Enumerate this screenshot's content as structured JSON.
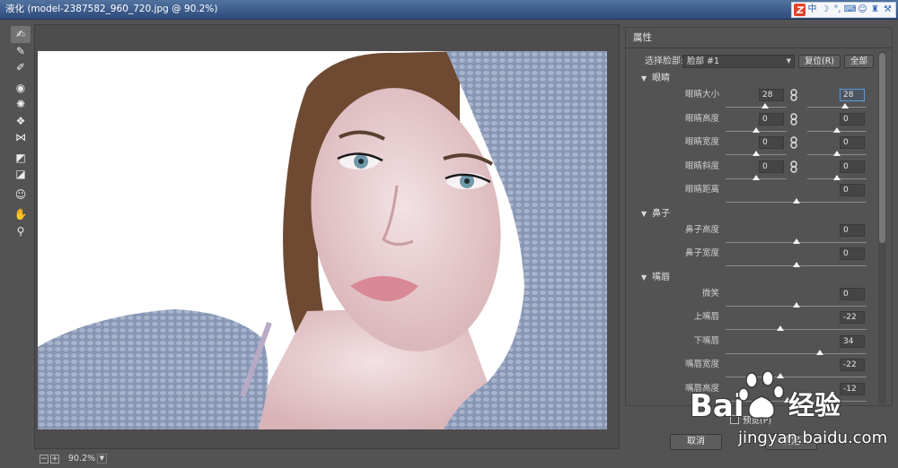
{
  "window": {
    "title": "液化 (model-2387582_960_720.jpg @ 90.2%)"
  },
  "ime": {
    "items": [
      {
        "icon": "sogou-logo-icon"
      },
      {
        "text": "中"
      },
      {
        "icon": "moon-icon"
      },
      {
        "icon": "punctuation-icon"
      },
      {
        "icon": "keyboard-icon"
      },
      {
        "icon": "user-icon"
      },
      {
        "icon": "skin-icon"
      },
      {
        "icon": "wrench-icon"
      }
    ]
  },
  "tools": [
    {
      "name": "forward-warp-tool",
      "icon": "forward-warp-icon",
      "active": true
    },
    {
      "name": "reconstruct-tool",
      "icon": "reconstruct-icon"
    },
    {
      "name": "smooth-tool",
      "icon": "smooth-icon"
    },
    {
      "name": "twirl-clockwise-tool",
      "icon": "twirl-icon"
    },
    {
      "name": "pucker-tool",
      "icon": "pucker-icon"
    },
    {
      "name": "bloat-tool",
      "icon": "bloat-icon"
    },
    {
      "name": "push-left-tool",
      "icon": "push-left-icon"
    },
    {
      "name": "freeze-mask-tool",
      "icon": "freeze-mask-icon"
    },
    {
      "name": "thaw-mask-tool",
      "icon": "thaw-mask-icon"
    },
    {
      "name": "face-tool",
      "icon": "face-icon"
    },
    {
      "name": "hand-tool",
      "icon": "hand-icon"
    },
    {
      "name": "zoom-tool",
      "icon": "zoom-icon"
    }
  ],
  "status": {
    "zoom_out_icon": "minus-icon",
    "zoom_in_icon": "plus-icon",
    "zoom": "90.2%",
    "zoom_menu_icon": "chevron-down-icon"
  },
  "properties": {
    "title": "属性",
    "face_select": {
      "label": "选择脸部:",
      "value": "脸部 #1",
      "reset_label": "复位(R)",
      "all_label": "全部"
    },
    "sections": [
      {
        "title": "眼睛",
        "rows": [
          {
            "label": "眼睛大小",
            "left": "28",
            "right": "28",
            "linked": true,
            "focused": "right"
          },
          {
            "label": "眼睛高度",
            "left": "0",
            "right": "0",
            "linked": true
          },
          {
            "label": "眼睛宽度",
            "left": "0",
            "right": "0",
            "linked": true
          },
          {
            "label": "眼睛斜度",
            "left": "0",
            "right": "0",
            "linked": true
          },
          {
            "label": "眼睛距离",
            "value": "0"
          }
        ]
      },
      {
        "title": "鼻子",
        "rows": [
          {
            "label": "鼻子高度",
            "value": "0"
          },
          {
            "label": "鼻子宽度",
            "value": "0"
          }
        ]
      },
      {
        "title": "嘴唇",
        "rows": [
          {
            "label": "微笑",
            "value": "0"
          },
          {
            "label": "上嘴唇",
            "value": "-22"
          },
          {
            "label": "下嘴唇",
            "value": "34"
          },
          {
            "label": "嘴唇宽度",
            "value": "-22"
          },
          {
            "label": "嘴唇高度",
            "value": "-12"
          }
        ]
      }
    ]
  },
  "footer": {
    "preview_label": "预览(P)",
    "cancel_label": "取消",
    "ok_label": "确定"
  },
  "watermark": {
    "brand": "Bai",
    "logo_icon": "baidu-paw-icon",
    "brand_suffix": "经验",
    "url": "jingyan.baidu.com"
  },
  "colors": {
    "dialog_bg": "#535353",
    "focus_border": "#5b9be0",
    "title_bar": "#2d4b7b",
    "ime_logo": "#e8412c"
  }
}
